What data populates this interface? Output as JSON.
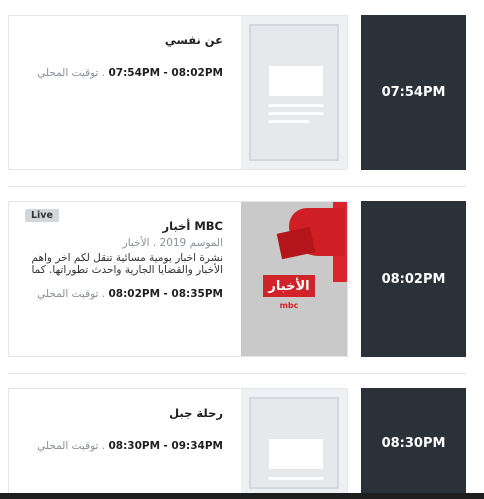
{
  "programs": [
    {
      "title": "عن نفسي",
      "start": "07:54PM",
      "end": "08:02PM",
      "timezone_label": "توقيت المحلي",
      "time_box": "07:54PM"
    },
    {
      "live_badge": "Live",
      "title": "MBC أخبار",
      "meta": "الموسم 2019 . الأخبار",
      "description": "نشرة اخبار يومية مسائية تنقل لكم اخر واهم الأخبار والقضايا الجارية واحدث تطوراتها. كما تضم",
      "start": "08:02PM",
      "end": "08:35PM",
      "timezone_label": "توقيت المحلي",
      "time_box": "08:02PM",
      "thumb_label": "الأخبار",
      "thumb_brand": "mbc"
    },
    {
      "title": "رحلة جبل",
      "start": "08:30PM",
      "end": "09:34PM",
      "timezone_label": "توقيت المحلي",
      "time_box": "08:30PM"
    }
  ],
  "colors": {
    "time_box_bg": "#2a3139",
    "placeholder_bg": "#eef0f3",
    "news_red": "#d0232a"
  }
}
